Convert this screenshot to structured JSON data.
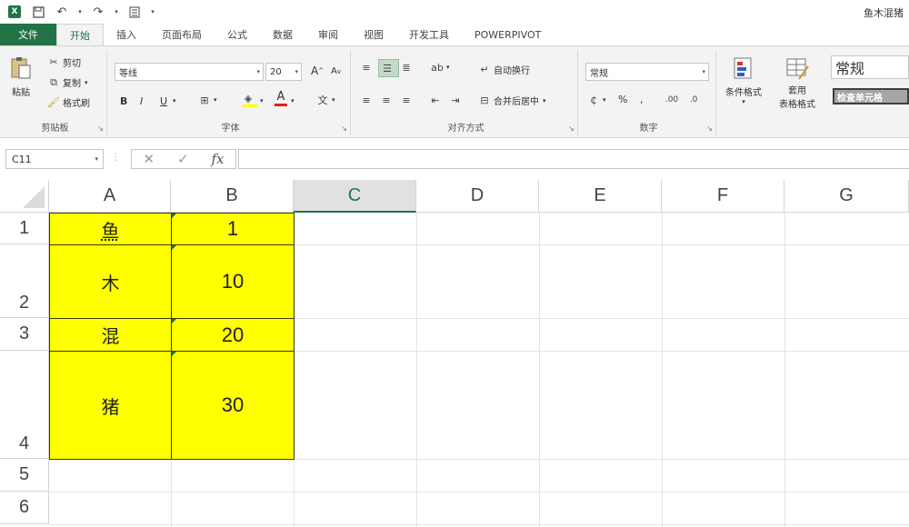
{
  "window": {
    "title": "鱼木混猪"
  },
  "quick_access": {
    "save_icon": "save-icon",
    "undo_icon": "undo-icon",
    "redo_icon": "redo-icon"
  },
  "tabs": [
    "文件",
    "开始",
    "插入",
    "页面布局",
    "公式",
    "数据",
    "审阅",
    "视图",
    "开发工具",
    "POWERPIVOT"
  ],
  "active_tab": "开始",
  "ribbon": {
    "clipboard": {
      "paste": "粘贴",
      "cut": "剪切",
      "copy": "复制",
      "format_painter": "格式刷",
      "label": "剪贴板"
    },
    "font": {
      "name": "等线",
      "size": "20",
      "label": "字体",
      "bold": "B",
      "italic": "I",
      "underline": "U",
      "grow": "A",
      "shrink": "A"
    },
    "alignment": {
      "wrap": "自动换行",
      "merge": "合并后居中",
      "label": "对齐方式"
    },
    "number": {
      "format": "常规",
      "label": "数字",
      "percent": "%",
      "comma": ","
    },
    "styles": {
      "conditional": "条件格式",
      "table": "套用",
      "table2": "表格格式",
      "normal": "常规",
      "check": "检查单元格"
    }
  },
  "formula_bar": {
    "name_box": "C11",
    "fx": "fx",
    "content": ""
  },
  "columns": [
    "A",
    "B",
    "C",
    "D",
    "E",
    "F",
    "G"
  ],
  "selected_column": "C",
  "rows": [
    "1",
    "2",
    "3",
    "4",
    "5",
    "6"
  ],
  "cells": {
    "A1": "鱼",
    "B1": "1",
    "A2": "木",
    "B2": "10",
    "A3": "混",
    "B3": "20",
    "A4": "猪",
    "B4": "30"
  },
  "colors": {
    "accent": "#217346",
    "fill": "#ffff00"
  }
}
